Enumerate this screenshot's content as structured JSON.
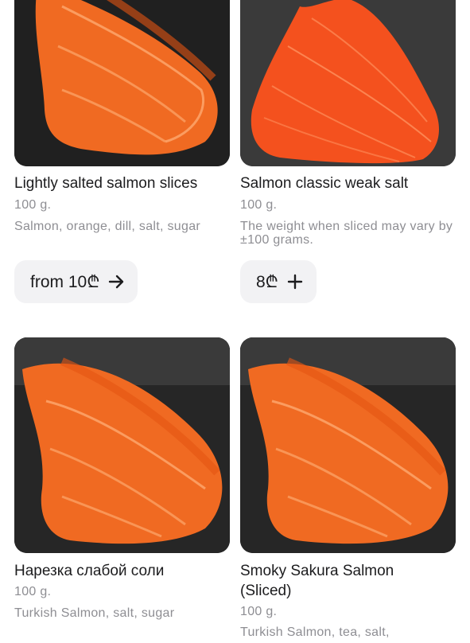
{
  "products": [
    {
      "title": "Lightly salted salmon slices",
      "weight": "100 g.",
      "description": "Salmon, orange, dill, salt, sugar",
      "price_label": "from 10₾",
      "action_icon": "arrow-right-icon"
    },
    {
      "title": "Salmon classic weak salt",
      "weight": "100 g.",
      "description": "The weight when sliced may vary by ±100 grams.",
      "price_label": "8₾",
      "action_icon": "plus-icon"
    },
    {
      "title": "Нарезка слабой соли",
      "weight": "100 g.",
      "description": "Turkish Salmon, salt, sugar"
    },
    {
      "title": "Smoky Sakura Salmon (Sliced)",
      "weight": "100 g.",
      "description": "Turkish Salmon, tea, salt,"
    }
  ],
  "colors": {
    "salmon": "#f0641e",
    "salmon_light": "#ff9a52",
    "button_bg": "#f2f2f4",
    "muted_text": "#8e8e93"
  }
}
